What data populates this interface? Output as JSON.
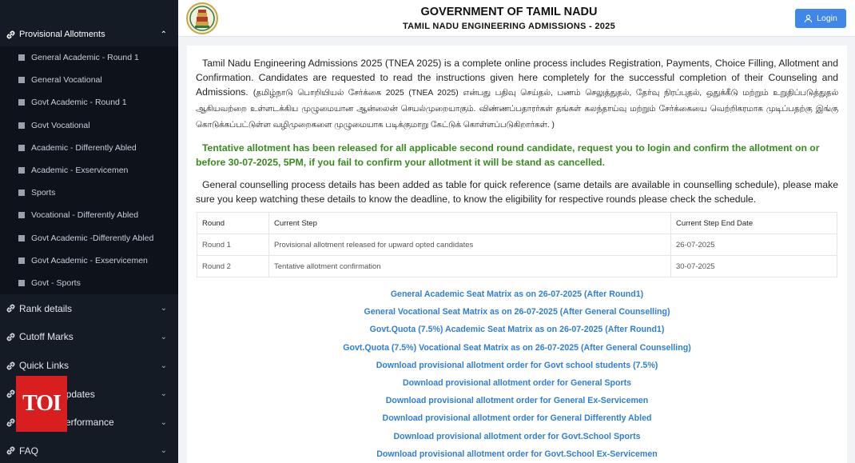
{
  "header": {
    "title": "GOVERNMENT OF TAMIL NADU",
    "subtitle": "TAMIL NADU ENGINEERING ADMISSIONS - 2025",
    "login_label": "Login"
  },
  "sidebar": {
    "group_label": "Provisional Allotments",
    "sub_items": [
      "General Academic - Round 1",
      "General Vocational",
      "Govt Academic - Round 1",
      "Govt Vocational",
      "Academic - Differently Abled",
      "Academic - Exservicemen",
      "Sports",
      "Vocational - Differently Abled",
      "Govt Academic -Differently Abled",
      "Govt Academic - Exservicemen",
      "Govt - Sports"
    ],
    "menu_items": [
      "Rank details",
      "Cutoff Marks",
      "Quick Links",
      "Updates",
      "Performance",
      "FAQ"
    ]
  },
  "watermark": "TOI",
  "main": {
    "intro_en": "Tamil Nadu Engineering Admissions 2025 (TNEA 2025) is a complete online process includes Registration, Payments, Choice Filling, Allotment and Confirmation. Candidates are requested to read the instructions given here completely for the successful completion of their Counseling and Admissions.",
    "intro_ta": "(தமிழ்நாடு பொறியியல் சேர்க்கை 2025 (TNEA 2025) என்பது பதிவு செய்தல், பணம் செலுத்துதல், தேர்வு நிரப்புதல், ஒதுக்கீடு மற்றும் உறுதிப்படுத்துதல் ஆகியவற்றை உள்ளடக்கிய முழுமையான ஆன்லைன் செயல்முறையாகும். விண்ணப்பதாரர்கள் தங்கள் கலந்தாய்வு மற்றும் சேர்க்கையை வெற்றிகரமாக முடிப்பதற்கு இங்கு கொடுக்கப்பட்டுள்ள வழிமுறைகளை முழுமையாக படிக்குமாறு கேட்டுக் கொள்ளப்படுகிறார்கள். )",
    "alert": "Tentative allotment has been released for all applicable second round candidate, request you to login and confirm the allotment on or before 30-07-2025, 5PM, if you fail to confirm your allotment it will be stand as cancelled.",
    "counselling_note": "General counselling process details has been added as table for quick reference (same details are available in counselling schedule), please make sure you keep watching these details to know the deadline, to know the eligibility for respective rounds please check the schedule.",
    "table": {
      "headers": [
        "Round",
        "Current Step",
        "Current Step End Date"
      ],
      "rows": [
        [
          "Round 1",
          "Provisional allotment released for upward opted candidates",
          "26-07-2025"
        ],
        [
          "Round 2",
          "Tentative allotment confirmation",
          "30-07-2025"
        ]
      ]
    },
    "links": [
      "General Academic Seat Matrix as on 26-07-2025 (After Round1)",
      "General Vocational Seat Matrix as on 26-07-2025 (After General Counselling)",
      "Govt.Quota (7.5%) Academic Seat Matrix as on 26-07-2025 (After Round1)",
      "Govt.Quota (7.5%) Vocational Seat Matrix as on 26-07-2025 (After General Counselling)",
      "Download provisional allotment order for Govt school students (7.5%)",
      "Download provisional allotment order for General Sports",
      "Download provisional allotment order for General Ex-Servicemen",
      "Download provisional allotment order for General Differently Abled",
      "Download provisional allotment order for Govt.School Sports",
      "Download provisional allotment order for Govt.School Ex-Servicemen"
    ]
  },
  "colors": {
    "sidebar_bg": "#151b25",
    "accent_blue": "#3f87e8",
    "link_blue": "#2f7fd6",
    "alert_green": "#3a8a1f",
    "watermark_red": "#d81e1e"
  },
  "icons": {
    "menu": "link-icon",
    "expanded": "chevron-up-icon",
    "collapsed": "chevron-down-icon",
    "login": "user-icon",
    "logo": "tamil-nadu-emblem-icon"
  }
}
